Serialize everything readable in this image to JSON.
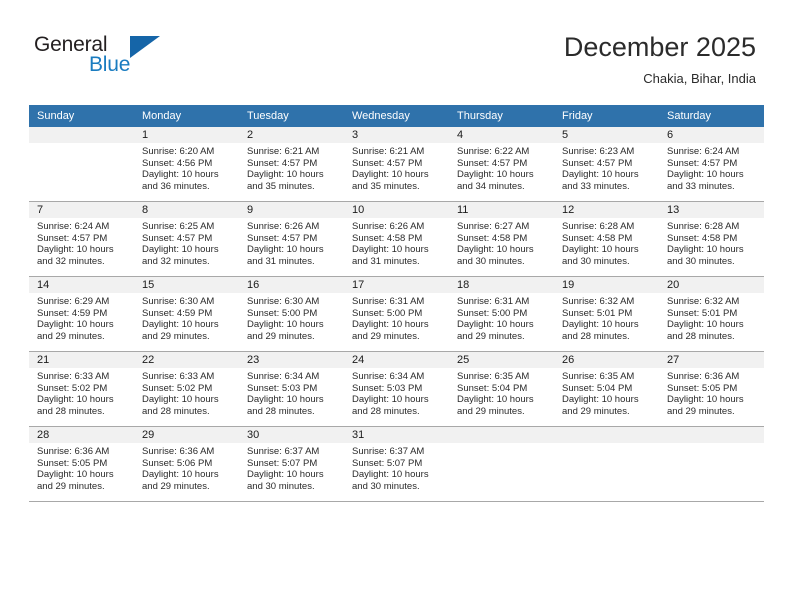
{
  "brand": {
    "name_top": "General",
    "name_bottom": "Blue",
    "accent_color": "#1565a8",
    "text_color": "#231f20"
  },
  "header": {
    "title": "December 2025",
    "subtitle": "Chakia, Bihar, India"
  },
  "calendar": {
    "header_bg": "#2f72ab",
    "daynum_bg": "#f1f1f1",
    "weekdays": [
      "Sunday",
      "Monday",
      "Tuesday",
      "Wednesday",
      "Thursday",
      "Friday",
      "Saturday"
    ],
    "weeks": [
      [
        {
          "day": "",
          "sunrise": "",
          "sunset": "",
          "daylight1": "",
          "daylight2": ""
        },
        {
          "day": "1",
          "sunrise": "Sunrise: 6:20 AM",
          "sunset": "Sunset: 4:56 PM",
          "daylight1": "Daylight: 10 hours",
          "daylight2": "and 36 minutes."
        },
        {
          "day": "2",
          "sunrise": "Sunrise: 6:21 AM",
          "sunset": "Sunset: 4:57 PM",
          "daylight1": "Daylight: 10 hours",
          "daylight2": "and 35 minutes."
        },
        {
          "day": "3",
          "sunrise": "Sunrise: 6:21 AM",
          "sunset": "Sunset: 4:57 PM",
          "daylight1": "Daylight: 10 hours",
          "daylight2": "and 35 minutes."
        },
        {
          "day": "4",
          "sunrise": "Sunrise: 6:22 AM",
          "sunset": "Sunset: 4:57 PM",
          "daylight1": "Daylight: 10 hours",
          "daylight2": "and 34 minutes."
        },
        {
          "day": "5",
          "sunrise": "Sunrise: 6:23 AM",
          "sunset": "Sunset: 4:57 PM",
          "daylight1": "Daylight: 10 hours",
          "daylight2": "and 33 minutes."
        },
        {
          "day": "6",
          "sunrise": "Sunrise: 6:24 AM",
          "sunset": "Sunset: 4:57 PM",
          "daylight1": "Daylight: 10 hours",
          "daylight2": "and 33 minutes."
        }
      ],
      [
        {
          "day": "7",
          "sunrise": "Sunrise: 6:24 AM",
          "sunset": "Sunset: 4:57 PM",
          "daylight1": "Daylight: 10 hours",
          "daylight2": "and 32 minutes."
        },
        {
          "day": "8",
          "sunrise": "Sunrise: 6:25 AM",
          "sunset": "Sunset: 4:57 PM",
          "daylight1": "Daylight: 10 hours",
          "daylight2": "and 32 minutes."
        },
        {
          "day": "9",
          "sunrise": "Sunrise: 6:26 AM",
          "sunset": "Sunset: 4:57 PM",
          "daylight1": "Daylight: 10 hours",
          "daylight2": "and 31 minutes."
        },
        {
          "day": "10",
          "sunrise": "Sunrise: 6:26 AM",
          "sunset": "Sunset: 4:58 PM",
          "daylight1": "Daylight: 10 hours",
          "daylight2": "and 31 minutes."
        },
        {
          "day": "11",
          "sunrise": "Sunrise: 6:27 AM",
          "sunset": "Sunset: 4:58 PM",
          "daylight1": "Daylight: 10 hours",
          "daylight2": "and 30 minutes."
        },
        {
          "day": "12",
          "sunrise": "Sunrise: 6:28 AM",
          "sunset": "Sunset: 4:58 PM",
          "daylight1": "Daylight: 10 hours",
          "daylight2": "and 30 minutes."
        },
        {
          "day": "13",
          "sunrise": "Sunrise: 6:28 AM",
          "sunset": "Sunset: 4:58 PM",
          "daylight1": "Daylight: 10 hours",
          "daylight2": "and 30 minutes."
        }
      ],
      [
        {
          "day": "14",
          "sunrise": "Sunrise: 6:29 AM",
          "sunset": "Sunset: 4:59 PM",
          "daylight1": "Daylight: 10 hours",
          "daylight2": "and 29 minutes."
        },
        {
          "day": "15",
          "sunrise": "Sunrise: 6:30 AM",
          "sunset": "Sunset: 4:59 PM",
          "daylight1": "Daylight: 10 hours",
          "daylight2": "and 29 minutes."
        },
        {
          "day": "16",
          "sunrise": "Sunrise: 6:30 AM",
          "sunset": "Sunset: 5:00 PM",
          "daylight1": "Daylight: 10 hours",
          "daylight2": "and 29 minutes."
        },
        {
          "day": "17",
          "sunrise": "Sunrise: 6:31 AM",
          "sunset": "Sunset: 5:00 PM",
          "daylight1": "Daylight: 10 hours",
          "daylight2": "and 29 minutes."
        },
        {
          "day": "18",
          "sunrise": "Sunrise: 6:31 AM",
          "sunset": "Sunset: 5:00 PM",
          "daylight1": "Daylight: 10 hours",
          "daylight2": "and 29 minutes."
        },
        {
          "day": "19",
          "sunrise": "Sunrise: 6:32 AM",
          "sunset": "Sunset: 5:01 PM",
          "daylight1": "Daylight: 10 hours",
          "daylight2": "and 28 minutes."
        },
        {
          "day": "20",
          "sunrise": "Sunrise: 6:32 AM",
          "sunset": "Sunset: 5:01 PM",
          "daylight1": "Daylight: 10 hours",
          "daylight2": "and 28 minutes."
        }
      ],
      [
        {
          "day": "21",
          "sunrise": "Sunrise: 6:33 AM",
          "sunset": "Sunset: 5:02 PM",
          "daylight1": "Daylight: 10 hours",
          "daylight2": "and 28 minutes."
        },
        {
          "day": "22",
          "sunrise": "Sunrise: 6:33 AM",
          "sunset": "Sunset: 5:02 PM",
          "daylight1": "Daylight: 10 hours",
          "daylight2": "and 28 minutes."
        },
        {
          "day": "23",
          "sunrise": "Sunrise: 6:34 AM",
          "sunset": "Sunset: 5:03 PM",
          "daylight1": "Daylight: 10 hours",
          "daylight2": "and 28 minutes."
        },
        {
          "day": "24",
          "sunrise": "Sunrise: 6:34 AM",
          "sunset": "Sunset: 5:03 PM",
          "daylight1": "Daylight: 10 hours",
          "daylight2": "and 28 minutes."
        },
        {
          "day": "25",
          "sunrise": "Sunrise: 6:35 AM",
          "sunset": "Sunset: 5:04 PM",
          "daylight1": "Daylight: 10 hours",
          "daylight2": "and 29 minutes."
        },
        {
          "day": "26",
          "sunrise": "Sunrise: 6:35 AM",
          "sunset": "Sunset: 5:04 PM",
          "daylight1": "Daylight: 10 hours",
          "daylight2": "and 29 minutes."
        },
        {
          "day": "27",
          "sunrise": "Sunrise: 6:36 AM",
          "sunset": "Sunset: 5:05 PM",
          "daylight1": "Daylight: 10 hours",
          "daylight2": "and 29 minutes."
        }
      ],
      [
        {
          "day": "28",
          "sunrise": "Sunrise: 6:36 AM",
          "sunset": "Sunset: 5:05 PM",
          "daylight1": "Daylight: 10 hours",
          "daylight2": "and 29 minutes."
        },
        {
          "day": "29",
          "sunrise": "Sunrise: 6:36 AM",
          "sunset": "Sunset: 5:06 PM",
          "daylight1": "Daylight: 10 hours",
          "daylight2": "and 29 minutes."
        },
        {
          "day": "30",
          "sunrise": "Sunrise: 6:37 AM",
          "sunset": "Sunset: 5:07 PM",
          "daylight1": "Daylight: 10 hours",
          "daylight2": "and 30 minutes."
        },
        {
          "day": "31",
          "sunrise": "Sunrise: 6:37 AM",
          "sunset": "Sunset: 5:07 PM",
          "daylight1": "Daylight: 10 hours",
          "daylight2": "and 30 minutes."
        },
        {
          "day": "",
          "sunrise": "",
          "sunset": "",
          "daylight1": "",
          "daylight2": ""
        },
        {
          "day": "",
          "sunrise": "",
          "sunset": "",
          "daylight1": "",
          "daylight2": ""
        },
        {
          "day": "",
          "sunrise": "",
          "sunset": "",
          "daylight1": "",
          "daylight2": ""
        }
      ]
    ]
  }
}
